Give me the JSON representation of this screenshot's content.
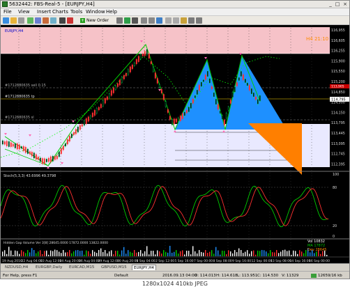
{
  "window": {
    "title": "5632442: FBS-Real-5 - [EURJPY,H4]",
    "controls": [
      "_",
      "□",
      "×"
    ]
  },
  "menu": [
    "File",
    "View",
    "Insert",
    "Charts",
    "Tools",
    "Window",
    "Help"
  ],
  "toolbar": {
    "new_order_label": "New Order"
  },
  "chart": {
    "symbol_label": "EURJPY,H4",
    "timer_label": "H4   21:10",
    "level_labels": {
      "l1": "#1712880635 sell 0.15",
      "l2": "#1712880635 tp",
      "l3": "#1712880635 sl"
    },
    "price_scale": [
      "116,955",
      "116,605",
      "116,255",
      "115,900",
      "115,550",
      "115,200",
      "114,850",
      "114,500",
      "114,150",
      "113,795",
      "113,445",
      "113,095",
      "112,745",
      "112,395"
    ],
    "current_price": "114,795",
    "red_tag": "113,905",
    "stoch_label": "Stoch(5,3,3) 43.6996 49.3798",
    "stoch_scale": [
      "100",
      "80",
      "20",
      "0"
    ],
    "volume_label": "Hidden Gap Volume Ver 3[8] 28645.0000 17872.0000 13822.0000",
    "vol_box": {
      "vol": "Vol  10832",
      "ma": "MA  17872",
      "dev": "Dev  28645"
    },
    "date_axis": [
      "19 Aug 2016",
      "22 Aug 04:00",
      "23 Aug 12:00",
      "24 Aug 20:00",
      "26 Aug 04:00",
      "29 Aug 12:00",
      "30 Aug 20:00",
      "1 Sep 04:00",
      "2 Sep 12:00",
      "5 Sep 16:00",
      "7 Sep 00:00",
      "8 Sep 08:00",
      "9 Sep 16:00",
      "12 Sep 00:00",
      "13 Sep 08:00",
      "14 Sep 16:00",
      "16 Sep 00:00"
    ]
  },
  "tabs": [
    "NZDUSD,H4",
    "EURGBP,Daily",
    "EURCAD,M15",
    "GBPUSD,M15",
    "EURJPY,H4"
  ],
  "status": {
    "help": "For Help, press F1",
    "profile": "Default",
    "time": "2016.09.13 04:00",
    "open": "O: 114.013",
    "high": "H: 114.618",
    "low": "L: 113.951",
    "close": "C: 114.530",
    "volume": "V: 11329",
    "traffic": "12659/16 kb"
  },
  "footer": {
    "caption": "1280x1024  410kb  JPEG"
  },
  "colors": {
    "accent_green": "#00cc00",
    "up_candle": "#00ff66",
    "pattern_blue": "#1e90ff",
    "pattern_orange": "#ff7f00",
    "zone_pink": "#f6c2c8",
    "zone_lavender": "#e9e9ff",
    "stoch_red": "#ff3030"
  }
}
